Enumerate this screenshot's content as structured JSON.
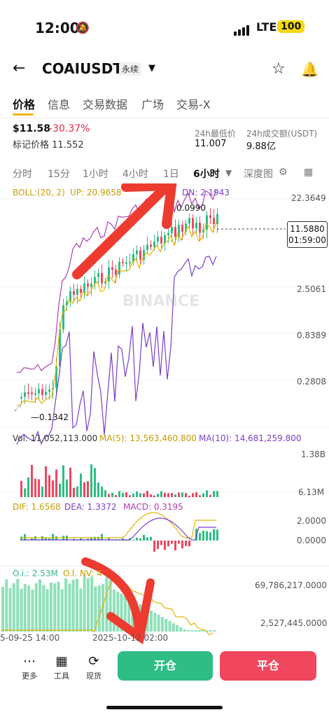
{
  "status_bar": {
    "time": "12:00",
    "network": "LTE",
    "battery": "100"
  },
  "header": {
    "pair": "COAIUSDT",
    "contract_type": "永续"
  },
  "tabs": [
    "价格",
    "信息",
    "交易数据",
    "广场",
    "交易-X"
  ],
  "ticker": {
    "price": "$11.58",
    "change": "-30.37%",
    "mark_label": "标记价格",
    "mark_value": "11.552",
    "low_label": "24h最低价",
    "low_value": "11.007",
    "volume_label": "24h成交额(USDT)",
    "volume_value": "9.88亿"
  },
  "intervals": [
    "分时",
    "15分",
    "1小时",
    "4小时",
    "1日",
    "6小时",
    "深度图"
  ],
  "chart": {
    "boll_legend": "BOLL:(20, 2)",
    "boll_up": "UP: 20.9658",
    "boll_dn": "DN: 2.1943",
    "y_ticks": [
      "22.3649",
      "2.5061",
      "0.8389",
      "0.2808"
    ],
    "high_marker": "0.0990",
    "low_marker": "0.1342",
    "current_price": "11.5880",
    "countdown": "01:59:00",
    "watermark": "BINANCE",
    "vol_legend": "Vol: 11,052,113.000",
    "ma5_legend": "MA(5): 13,563,460.800",
    "ma10_legend": "MA(10): 14,681,259.800",
    "vol_ticks": [
      "1.38B",
      "6.13M"
    ],
    "dif_legend": "DIF: 1.6568",
    "dea_legend": "DEA: 1.3372",
    "macd_legend": "MACD: 0.3195",
    "macd_ticks": [
      "2.0000",
      "0.0000"
    ],
    "oi_legend": "O.i.: 2.53M",
    "oinv_legend": "O.I. NV: 4",
    "oi_ticks": [
      "69,786,217.0000",
      "2,527,445.0000"
    ],
    "x_ticks": [
      "5-09-25 14:00",
      "2025-10-12 02:00"
    ]
  },
  "bottom": {
    "more_label": "更多",
    "tools_label": "工具",
    "spot_label": "现货",
    "open_label": "开仓",
    "close_label": "平仓"
  },
  "colors": {
    "up": "#2ebd85",
    "down": "#f0465e",
    "accent": "#f0b90b",
    "arrow": "#ee3b30"
  }
}
